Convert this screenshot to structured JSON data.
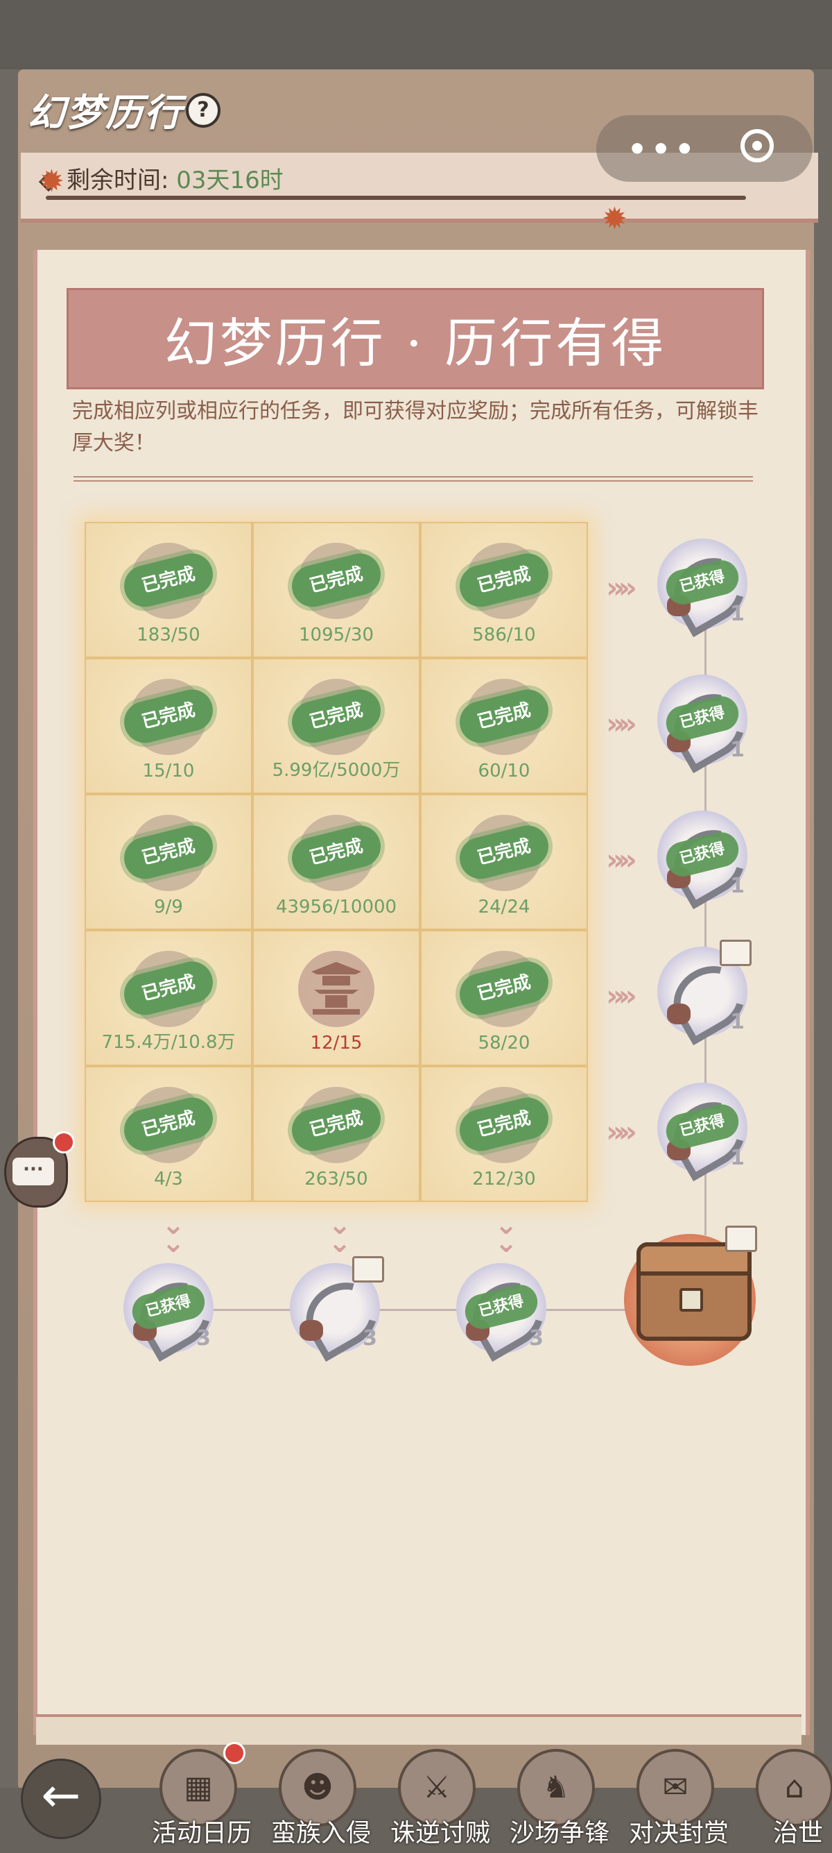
{
  "header": {
    "title": "幻梦历行",
    "help_icon": "question-circle-icon",
    "remaining_label": "剩余时间:",
    "remaining_value": "03天16时"
  },
  "capsule": {
    "more_icon": "more-dots-icon",
    "close_icon": "target-circle-icon"
  },
  "banner": {
    "title": "幻梦历行 · 历行有得"
  },
  "description": "完成相应列或相应行的任务，即可获得对应奖励；完成所有任务，可解锁丰厚大奖！",
  "grid": {
    "completed_label": "已完成",
    "cells": [
      {
        "progress": "183/50",
        "done": true
      },
      {
        "progress": "1095/30",
        "done": true
      },
      {
        "progress": "586/10",
        "done": true
      },
      {
        "progress": "15/10",
        "done": true
      },
      {
        "progress": "5.99亿/5000万",
        "done": true
      },
      {
        "progress": "60/10",
        "done": true
      },
      {
        "progress": "9/9",
        "done": true
      },
      {
        "progress": "43956/10000",
        "done": true
      },
      {
        "progress": "24/24",
        "done": true
      },
      {
        "progress": "715.4万/10.8万",
        "done": true
      },
      {
        "progress": "12/15",
        "done": false
      },
      {
        "progress": "58/20",
        "done": true
      },
      {
        "progress": "4/3",
        "done": true
      },
      {
        "progress": "263/50",
        "done": true
      },
      {
        "progress": "212/30",
        "done": true
      }
    ]
  },
  "row_rewards": {
    "claimed_label": "已获得",
    "items": [
      {
        "qty": "1",
        "claimed": true
      },
      {
        "qty": "1",
        "claimed": true
      },
      {
        "qty": "1",
        "claimed": true
      },
      {
        "qty": "1",
        "claimed": false
      },
      {
        "qty": "1",
        "claimed": true
      }
    ]
  },
  "column_rewards": {
    "items": [
      {
        "qty": "3",
        "claimed": true
      },
      {
        "qty": "3",
        "claimed": false
      },
      {
        "qty": "3",
        "claimed": true
      }
    ]
  },
  "grand_reward": {
    "icon": "treasure-chest-icon"
  },
  "side": {
    "chat_text": "···"
  },
  "bottom_nav": {
    "back_icon": "back-arrow-icon",
    "items": [
      {
        "label": "活动日历",
        "icon": "calendar-icon"
      },
      {
        "label": "蛮族入侵",
        "icon": "barbarian-icon"
      },
      {
        "label": "诛逆讨贼",
        "icon": "warrior-icon"
      },
      {
        "label": "沙场争锋",
        "icon": "cavalry-icon"
      },
      {
        "label": "对决封赏",
        "icon": "scroll-icon"
      },
      {
        "label": "治世",
        "icon": "city-icon"
      }
    ]
  },
  "colors": {
    "completed_green": "#5f9a5a",
    "pending_red": "#b93c33",
    "banner": "#c79089"
  }
}
